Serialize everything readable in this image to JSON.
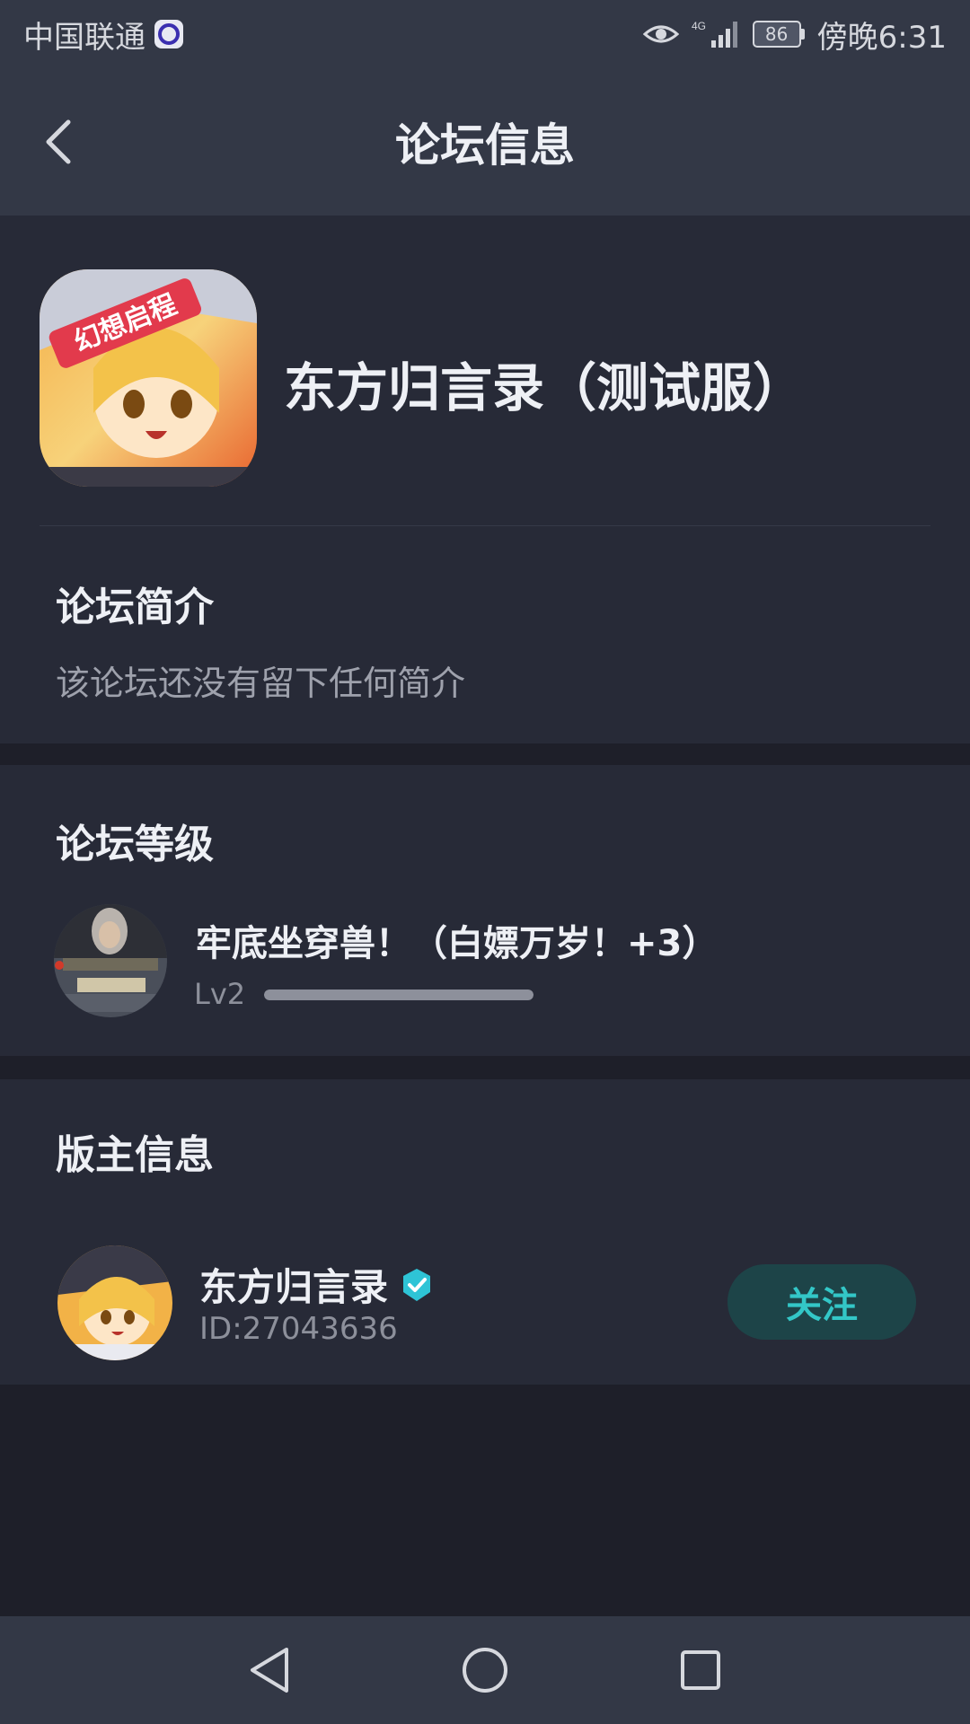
{
  "status_bar": {
    "carrier": "中国联通",
    "network": "4G",
    "battery": "86",
    "time": "傍晚6:31"
  },
  "header": {
    "title": "论坛信息",
    "back_icon": "chevron-left-icon"
  },
  "forum": {
    "name": "东方归言录（测试服）",
    "icon_badge_text": "幻想启程",
    "intro_heading": "论坛简介",
    "intro_text": "该论坛还没有留下任何简介"
  },
  "level": {
    "heading": "论坛等级",
    "title": "牢底坐穿兽！（白嫖万岁！+3）",
    "lv_label": "Lv2",
    "progress": 1.0
  },
  "owner": {
    "heading": "版主信息",
    "name": "东方归言录",
    "id_text": "ID:27043636",
    "follow_label": "关注",
    "verified_color": "#2ec4d6"
  },
  "colors": {
    "bar_bg": "#333846",
    "section_bg": "#272a37",
    "accent": "#33c7c7"
  },
  "nav": {
    "back": "triangle-back-icon",
    "home": "circle-home-icon",
    "recents": "square-recents-icon"
  }
}
